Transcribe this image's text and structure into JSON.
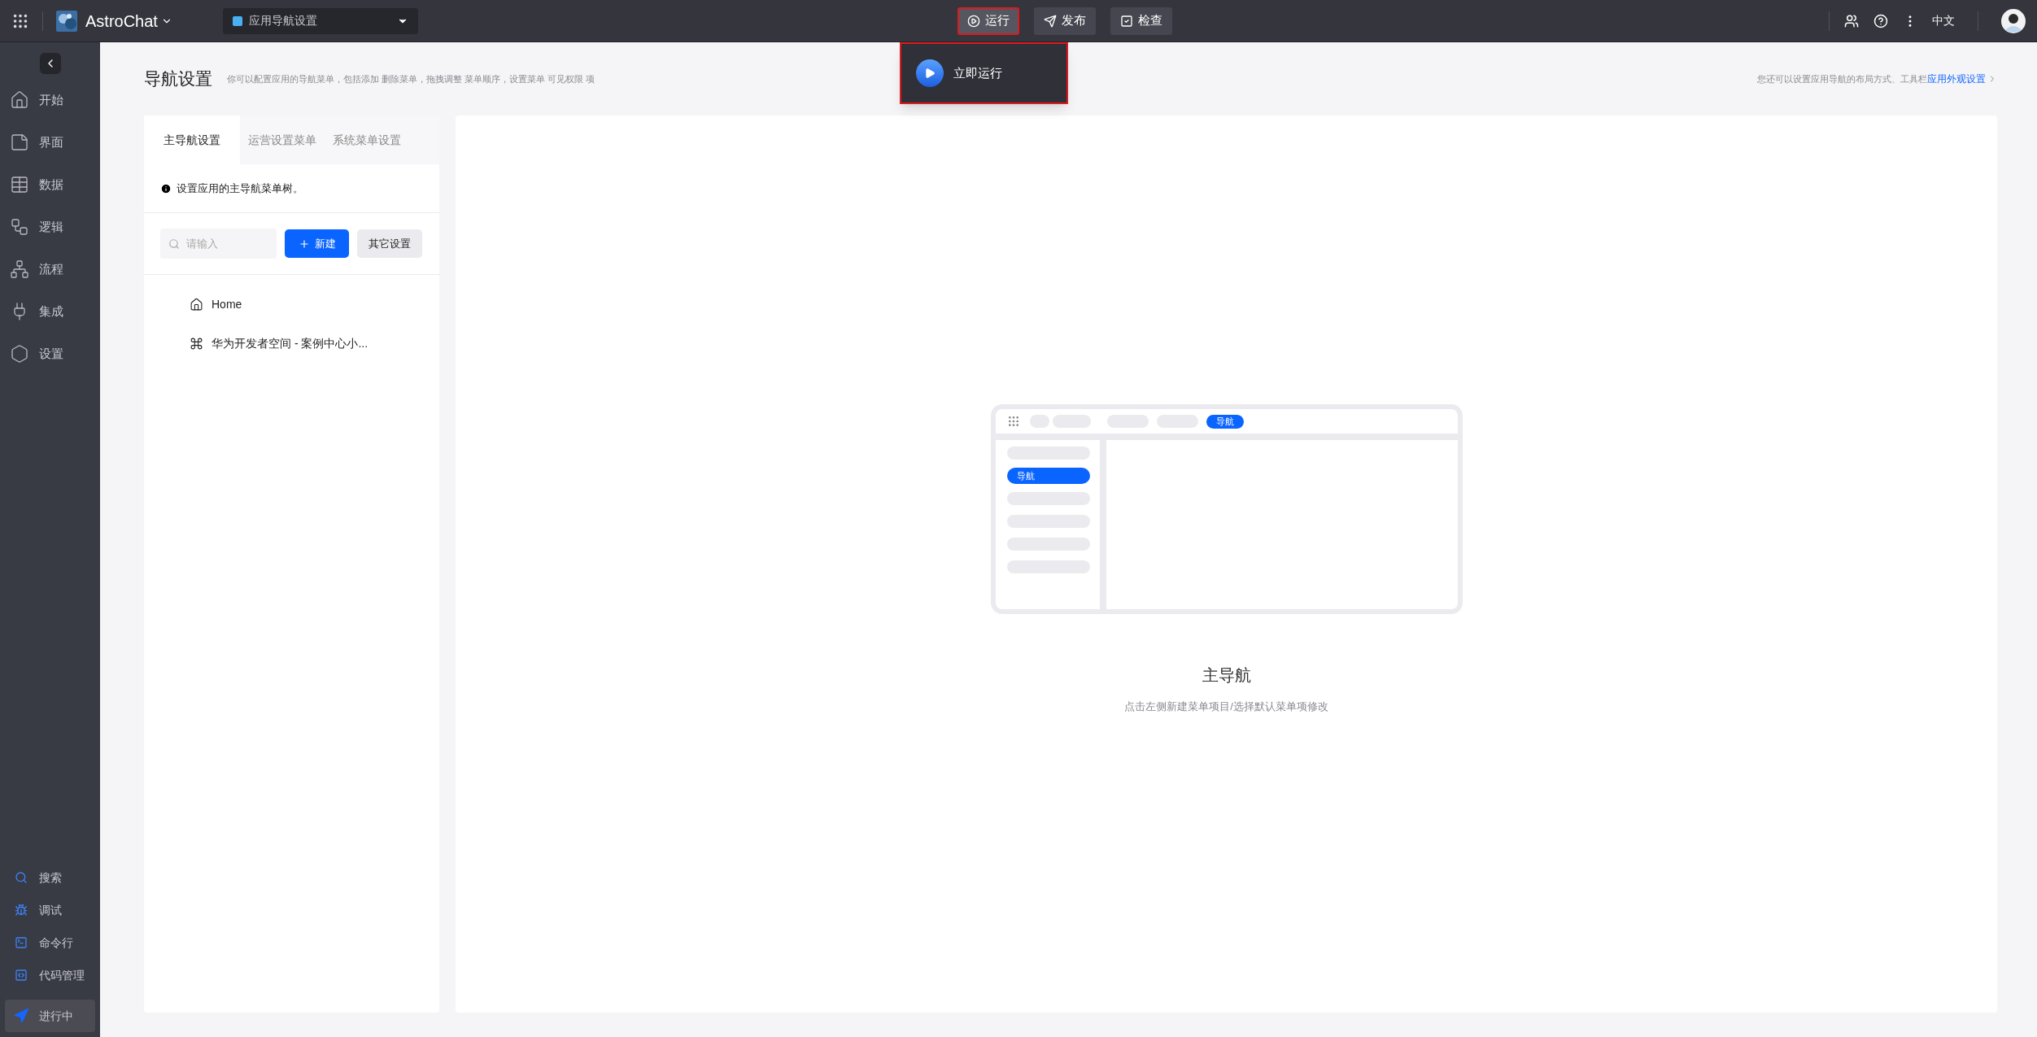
{
  "topbar": {
    "app_name": "AstroChat",
    "page_selector": "应用导航设置",
    "actions": [
      {
        "label": "运行",
        "kind": "run",
        "highlighted": true
      },
      {
        "label": "发布",
        "kind": "publish",
        "highlighted": false
      },
      {
        "label": "检查",
        "kind": "check",
        "highlighted": false
      }
    ],
    "language": "中文"
  },
  "run_menu": {
    "item": "立即运行",
    "highlighted": true
  },
  "sidebar": {
    "items": [
      {
        "label": "开始",
        "kind": "home"
      },
      {
        "label": "界面",
        "kind": "page"
      },
      {
        "label": "数据",
        "kind": "table"
      },
      {
        "label": "逻辑",
        "kind": "logic"
      },
      {
        "label": "流程",
        "kind": "flow"
      },
      {
        "label": "集成",
        "kind": "plug"
      },
      {
        "label": "设置",
        "kind": "settings"
      }
    ],
    "tools": [
      {
        "label": "搜索",
        "kind": "search"
      },
      {
        "label": "调试",
        "kind": "debug"
      },
      {
        "label": "命令行",
        "kind": "terminal"
      },
      {
        "label": "代码管理",
        "kind": "code"
      }
    ],
    "status": "进行中"
  },
  "header": {
    "title": "导航设置",
    "description": "你可以配置应用的导航菜单，包括添加 删除菜单，拖拽调整 菜单顺序，设置菜单 可见权限 项",
    "hint": "您还可以设置应用导航的布局方式、工具栏",
    "hint_link": "应用外观设置"
  },
  "tabs": [
    {
      "label": "主导航设置",
      "selected": true
    },
    {
      "label": "运营设置菜单",
      "selected": false
    },
    {
      "label": "系统菜单设置",
      "selected": false
    }
  ],
  "notice": "设置应用的主导航菜单树。",
  "search": {
    "placeholder": "请输入"
  },
  "new_button": "新建",
  "other_button": "其它设置",
  "tree": [
    {
      "label": "Home",
      "kind": "home"
    },
    {
      "label": "华为开发者空间 - 案例中心小...",
      "kind": "app"
    }
  ],
  "illustration": {
    "top_tag": "导航",
    "side_tag": "导航"
  },
  "empty_state": {
    "title": "主导航",
    "hint": "点击左侧新建菜单项目/选择默认菜单项修改"
  }
}
